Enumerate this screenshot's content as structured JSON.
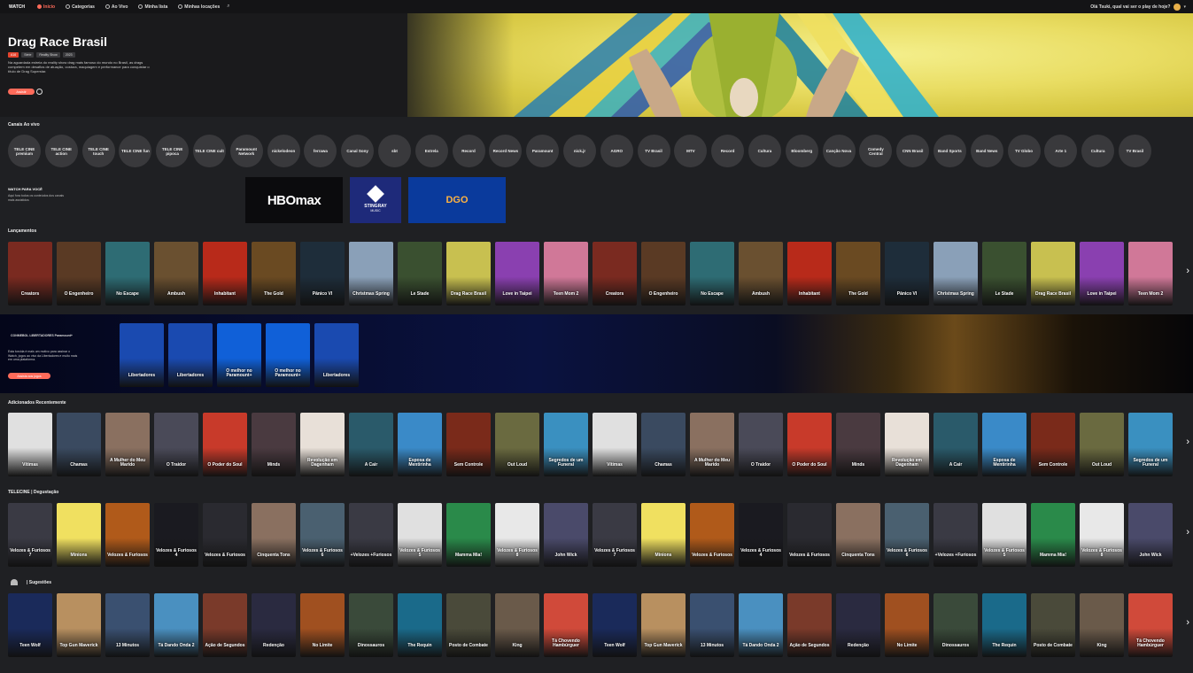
{
  "nav": {
    "logo": "WATCH",
    "items": [
      {
        "label": "Início"
      },
      {
        "label": "Categorias"
      },
      {
        "label": "Ao Vivo"
      },
      {
        "label": "Minha lista"
      },
      {
        "label": "Minhas locações"
      }
    ],
    "greeting": "Olá Tsuki, qual vai ser o play de hoje?"
  },
  "hero": {
    "title": "Drag Race Brasil",
    "tags": [
      "A16",
      "Série",
      "Reality Show",
      "2023"
    ],
    "description": "Na aguardada estreia do reality show drag mais famoso do mundo no Brasil, as drags competem em desafios de atuação, costura, maquiagem e performance para conquistar o título de Drag Superstar.",
    "button_label": "Assistir",
    "colors": {
      "accent": "#ff6b5a",
      "art": "#e9dd63"
    }
  },
  "channels": {
    "title": "Canais Ao vivo",
    "items": [
      "TELE CINE premium",
      "TELE CINE action",
      "TELE CINE touch",
      "TELE CINE fun",
      "TELE CINE pipoca",
      "TELE CINE cult",
      "Paramount Network",
      "nickelodeon",
      "ferrawa",
      "Canal Sony",
      "sbt",
      "Estrela",
      "Record",
      "Record News",
      "Paramount",
      "nick.jr",
      "AGRO",
      "TV Brasil",
      "MTV",
      "Record",
      "Cultura",
      "Bloomberg",
      "Canção Nova",
      "Comedy Central",
      "CNN Brasil",
      "Band Sports",
      "Band News",
      "TV Globo",
      "Arte 1",
      "Cultura",
      "TV Brasil"
    ]
  },
  "partners": {
    "title": "WATCH PARA VOCÊ",
    "description": "Aqui fora todos os conteúdos dos canais mais assistidos",
    "items": [
      {
        "label": "HBOmax"
      },
      {
        "label": "STINGRAY",
        "sublabel": "MUSIC"
      },
      {
        "label": "DGO"
      }
    ]
  },
  "lancamentos": {
    "title": "Lançamentos",
    "posters": [
      {
        "title": "Creators",
        "color": "#7a2a20"
      },
      {
        "title": "O Engenheiro",
        "color": "#5a3a24"
      },
      {
        "title": "No Escape",
        "color": "#2e6c74"
      },
      {
        "title": "Ambush",
        "color": "#6a5030"
      },
      {
        "title": "Inhabitant",
        "color": "#b82a1a"
      },
      {
        "title": "The Gold",
        "color": "#6a4a22"
      },
      {
        "title": "Pânico VI",
        "color": "#1e2d3a"
      },
      {
        "title": "Christmas Spring",
        "color": "#8aa0b8"
      },
      {
        "title": "Le Stade",
        "color": "#3a5030"
      },
      {
        "title": "Drag Race Brasil",
        "color": "#c8c050"
      },
      {
        "title": "Love in Taipei",
        "color": "#8a40b0"
      },
      {
        "title": "Teen Mom 2",
        "color": "#d07898"
      }
    ]
  },
  "promo": {
    "logo": "CONMEBOL LIBERTADORES Paramount+",
    "text": "Esta torcida é mais um motivo para assinar o Watch, jogos ao vivo da Libertadores e muito mais em uma plataforma.",
    "button_label": "Assista aos jogos",
    "posters": [
      {
        "title": "Libertadores",
        "color": "#1a4ab0"
      },
      {
        "title": "Libertadores",
        "color": "#1a4ab0"
      },
      {
        "title": "O melhor no Paramount+",
        "color": "#1060d8"
      },
      {
        "title": "O melhor no Paramount+",
        "color": "#1060d8"
      },
      {
        "title": "Libertadores",
        "color": "#1a4ab0"
      }
    ]
  },
  "recentes": {
    "title": "Adicionados Recentemente",
    "posters": [
      {
        "title": "Vítimas",
        "color": "#e0e0e0"
      },
      {
        "title": "Chamas",
        "color": "#3a4a60"
      },
      {
        "title": "A Mulher do Meu Marido",
        "color": "#8a7060"
      },
      {
        "title": "O Traidor",
        "color": "#4a4a58"
      },
      {
        "title": "O Poder do Soul",
        "color": "#c83a2a"
      },
      {
        "title": "Minds",
        "color": "#4a3a40"
      },
      {
        "title": "Revolução em Dagenham",
        "color": "#e8e0d8"
      },
      {
        "title": "A Cair",
        "color": "#2a5a6a"
      },
      {
        "title": "Esposa de Mentirinha",
        "color": "#3a8ac8"
      },
      {
        "title": "Sem Controle",
        "color": "#7a2a1a"
      },
      {
        "title": "Out Loud",
        "color": "#6a6a40"
      },
      {
        "title": "Segredos de um Funeral",
        "color": "#3a90c0"
      }
    ]
  },
  "telecine": {
    "title": "TELECINE | Degustação",
    "posters": [
      {
        "title": "Velozes & Furiosos 7",
        "color": "#3a3a44"
      },
      {
        "title": "Minions",
        "color": "#f0e060"
      },
      {
        "title": "Velozes & Furiosos",
        "color": "#b05a1a"
      },
      {
        "title": "Velozes & Furiosos 4",
        "color": "#1a1a20"
      },
      {
        "title": "Velozes & Furiosos",
        "color": "#2a2a30"
      },
      {
        "title": "Cinquenta Tons",
        "color": "#8a7060"
      },
      {
        "title": "Velozes & Furiosos 6",
        "color": "#4a6070"
      },
      {
        "title": "+Velozes +Furiosos",
        "color": "#3a3a44"
      },
      {
        "title": "Velozes & Furiosos 5",
        "color": "#e0e0e0"
      },
      {
        "title": "Mamma Mia!",
        "color": "#2a8a4a"
      },
      {
        "title": "Velozes & Furiosos 8",
        "color": "#e8e8e8"
      },
      {
        "title": "John Wick",
        "color": "#4a4a6a"
      }
    ]
  },
  "sugestoes": {
    "title": "| Sugestões",
    "posters": [
      {
        "title": "Teen Wolf",
        "color": "#1a2a5a"
      },
      {
        "title": "Top Gun Maverick",
        "color": "#b89060"
      },
      {
        "title": "13 Minutos",
        "color": "#3a5070"
      },
      {
        "title": "Tá Dando Onda 2",
        "color": "#4a90c0"
      },
      {
        "title": "Ação de Segundos",
        "color": "#7a3a2a"
      },
      {
        "title": "Redenção",
        "color": "#2a2a40"
      },
      {
        "title": "No Limite",
        "color": "#a05020"
      },
      {
        "title": "Dinossauros",
        "color": "#3a4a3a"
      },
      {
        "title": "The Requin",
        "color": "#1a6a8a"
      },
      {
        "title": "Posto de Combate",
        "color": "#4a4a3a"
      },
      {
        "title": "King",
        "color": "#6a5a4a"
      },
      {
        "title": "Tá Chovendo Hambúrguer",
        "color": "#d04a3a"
      }
    ]
  }
}
